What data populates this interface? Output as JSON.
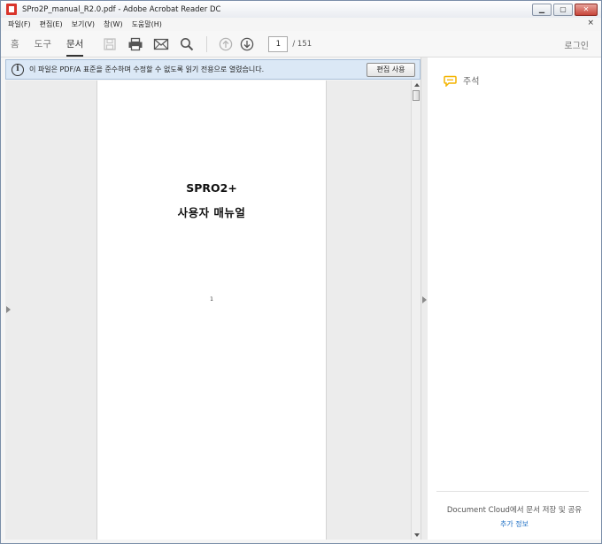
{
  "window": {
    "title": "SPro2P_manual_R2.0.pdf - Adobe Acrobat Reader DC",
    "minimize": "▁",
    "maximize": "▢",
    "close": "✕"
  },
  "menu": {
    "items": [
      "파일(F)",
      "편집(E)",
      "보기(V)",
      "창(W)",
      "도움말(H)"
    ],
    "close_doc": "×"
  },
  "toolbar": {
    "tabs": [
      "홈",
      "도구",
      "문서"
    ],
    "active_tab": "문서",
    "icons": [
      "save-icon",
      "print-icon",
      "email-icon",
      "search-icon",
      "page-up-icon",
      "page-down-icon"
    ],
    "page_current": "1",
    "page_total": "/ 151",
    "login_label": "로그인"
  },
  "infobar": {
    "icon": "info-icon",
    "icon_glyph": "i",
    "message": "이 파일은 PDF/A 표준을 준수하며 수정할 수 없도록 읽기 전용으로 열렸습니다.",
    "edit_button": "편집 사용"
  },
  "document": {
    "title_line1": "SPRO2+",
    "title_line2": "사용자 매뉴얼",
    "page_number": "1"
  },
  "right_pane": {
    "comment_label": "주석",
    "cloud_text": "Document Cloud에서 문서 저장 및 공유",
    "more_link": "추가 정보"
  },
  "colors": {
    "infobar_bg": "#dbe8f6",
    "comment_icon": "#f4b400",
    "link": "#1e6fc4"
  }
}
